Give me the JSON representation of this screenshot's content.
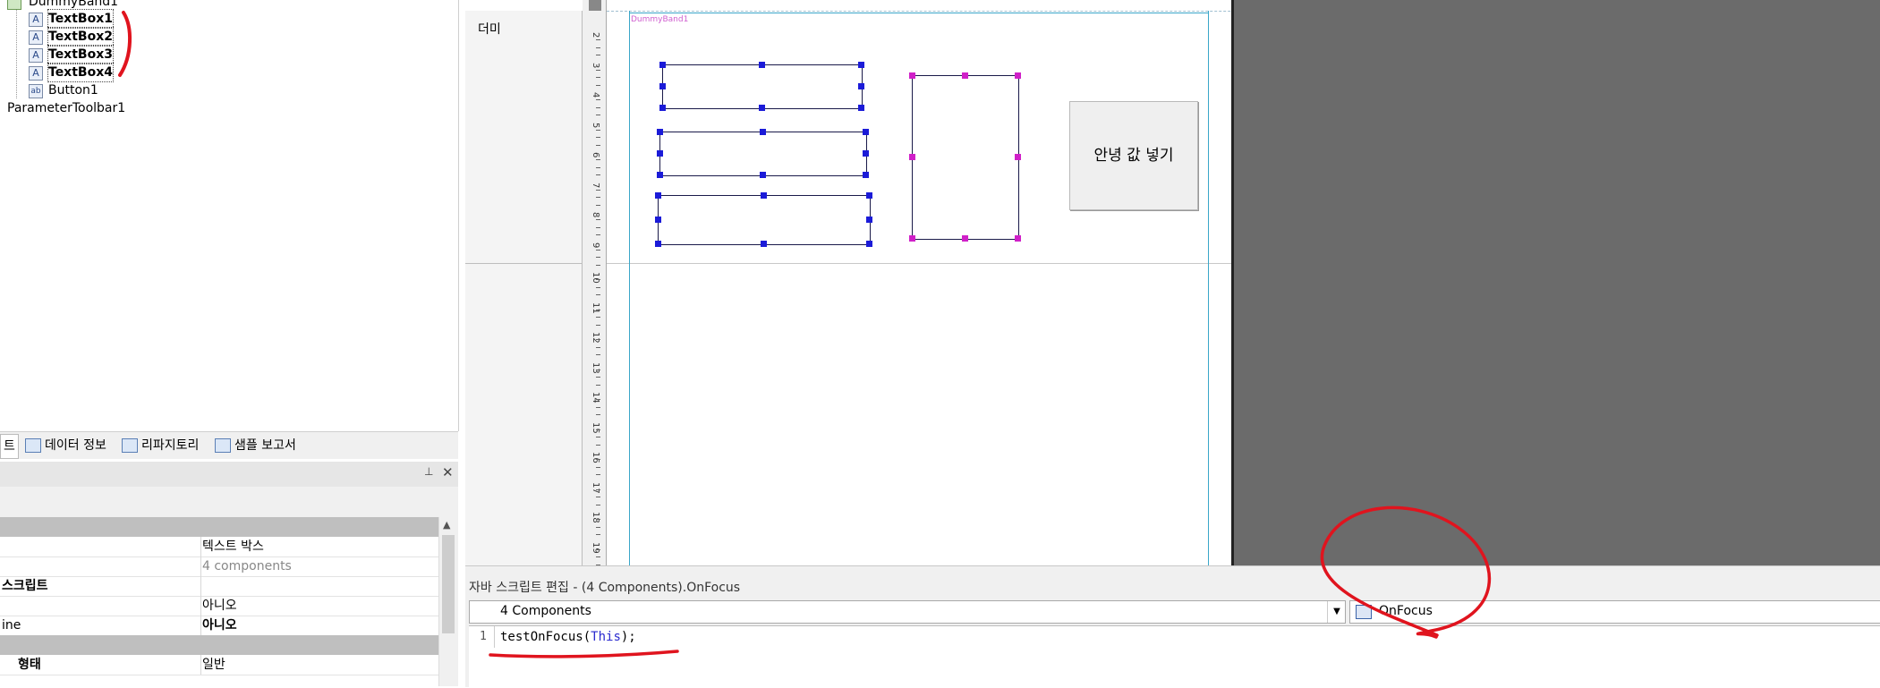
{
  "tree": {
    "items": [
      {
        "label": "DummyBand1",
        "icon": "band-icon",
        "bold": false
      },
      {
        "label": "TextBox1",
        "icon": "A",
        "bold": true
      },
      {
        "label": "TextBox2",
        "icon": "A",
        "bold": true
      },
      {
        "label": "TextBox3",
        "icon": "A",
        "bold": true
      },
      {
        "label": "TextBox4",
        "icon": "A",
        "bold": true
      },
      {
        "label": "Button1",
        "icon": "ab",
        "bold": false
      },
      {
        "label": "ParameterToolbar1",
        "icon": "",
        "bold": false
      }
    ]
  },
  "bottom_tabs": {
    "partial": "트",
    "items": [
      {
        "label": "데이터 정보",
        "icon": "data-info-icon"
      },
      {
        "label": "리파지토리",
        "icon": "repository-icon"
      },
      {
        "label": "샘플 보고서",
        "icon": "sample-report-icon"
      }
    ]
  },
  "panel_controls": {
    "pin": "ㅁ",
    "close": "✕"
  },
  "properties": {
    "rows": [
      {
        "key": "",
        "value": "",
        "category": true
      },
      {
        "key": "",
        "value": "텍스트 박스",
        "category": false,
        "value_style": "normal"
      },
      {
        "key": "",
        "value": "4 components",
        "category": false,
        "value_style": "gray"
      },
      {
        "key": "스크립트",
        "value": "",
        "category": false,
        "key_style": "bold"
      },
      {
        "key": "",
        "value": "아니오",
        "category": false,
        "value_style": "normal"
      },
      {
        "key": "ine",
        "value": "아니오",
        "category": false,
        "value_style": "bold"
      },
      {
        "key": "",
        "value": "",
        "category": true
      },
      {
        "key": "형태",
        "value": "일반",
        "category": false,
        "value_style": "normal",
        "key_style": "bold"
      }
    ]
  },
  "designer": {
    "band_label": "더미",
    "band_name": "DummyBand1",
    "ruler_numbers": [
      "2",
      "3",
      "4",
      "5",
      "6",
      "7",
      "8",
      "9",
      "10",
      "11",
      "12",
      "13",
      "14",
      "15",
      "16",
      "17",
      "18",
      "19"
    ],
    "button_label": "안녕 값 넣기"
  },
  "script_editor": {
    "title": "자바 스크립트 편집 - (4 Components).OnFocus",
    "object_select": "4 Components",
    "event_select": "OnFocus",
    "line_number": "1",
    "code_fn": "testOnFocus(",
    "code_arg": "This",
    "code_end": ");"
  },
  "colors": {
    "selection_handle": "#1b1bd8",
    "secondary_handle": "#d020c8",
    "annotation": "#e0141e",
    "canvas_gray": "#6b6b6b",
    "margin_line": "#3aa6c9"
  }
}
